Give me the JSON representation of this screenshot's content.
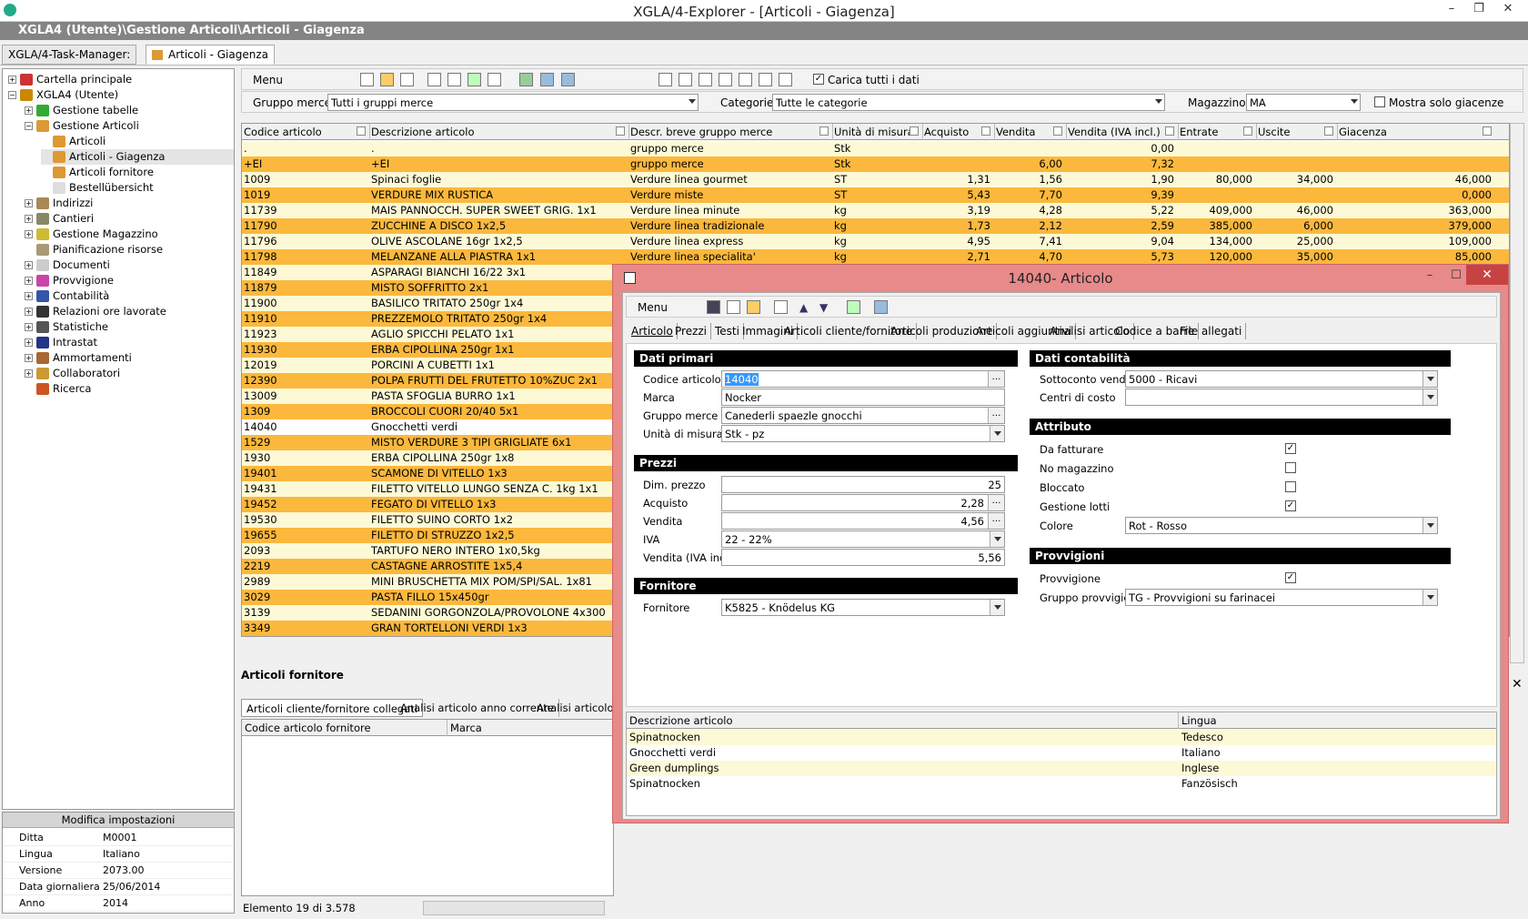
{
  "window": {
    "title": "XGLA/4-Explorer - [Articoli - Giagenza]",
    "path": "XGLA4 (Utente)\\Gestione Articoli\\Articoli - Giagenza"
  },
  "taskbar": {
    "tabs": [
      {
        "label": "XGLA/4-Task-Manager:"
      },
      {
        "label": "Articoli - Giagenza"
      }
    ]
  },
  "tree": {
    "items": [
      {
        "label": "Cartella principale",
        "level": 0,
        "exp": "+",
        "color": "#c33"
      },
      {
        "label": "XGLA4 (Utente)",
        "level": 0,
        "exp": "−",
        "color": "#c80"
      },
      {
        "label": "Gestione tabelle",
        "level": 1,
        "exp": "+",
        "color": "#3a3"
      },
      {
        "label": "Gestione Articoli",
        "level": 1,
        "exp": "−",
        "color": "#d93"
      },
      {
        "label": "Articoli",
        "level": 2,
        "exp": "",
        "color": "#d93"
      },
      {
        "label": "Articoli - Giagenza",
        "level": 2,
        "exp": "",
        "color": "#d93"
      },
      {
        "label": "Articoli fornitore",
        "level": 2,
        "exp": "",
        "color": "#d93"
      },
      {
        "label": "Bestellübersicht",
        "level": 2,
        "exp": "",
        "color": "#ddd"
      },
      {
        "label": "Indirizzi",
        "level": 1,
        "exp": "+",
        "color": "#a85"
      },
      {
        "label": "Cantieri",
        "level": 1,
        "exp": "+",
        "color": "#886"
      },
      {
        "label": "Gestione Magazzino",
        "level": 1,
        "exp": "+",
        "color": "#cb3"
      },
      {
        "label": "Pianificazione risorse",
        "level": 1,
        "exp": "",
        "color": "#a97"
      },
      {
        "label": "Documenti",
        "level": 1,
        "exp": "+",
        "color": "#ccc"
      },
      {
        "label": "Provvigione",
        "level": 1,
        "exp": "+",
        "color": "#c4a"
      },
      {
        "label": "Contabilità",
        "level": 1,
        "exp": "+",
        "color": "#35a"
      },
      {
        "label": "Relazioni ore lavorate",
        "level": 1,
        "exp": "+",
        "color": "#333"
      },
      {
        "label": "Statistiche",
        "level": 1,
        "exp": "+",
        "color": "#555"
      },
      {
        "label": "Intrastat",
        "level": 1,
        "exp": "+",
        "color": "#238"
      },
      {
        "label": "Ammortamenti",
        "level": 1,
        "exp": "+",
        "color": "#a63"
      },
      {
        "label": "Collaboratori",
        "level": 1,
        "exp": "+",
        "color": "#c93"
      },
      {
        "label": "Ricerca",
        "level": 1,
        "exp": "",
        "color": "#c52"
      }
    ]
  },
  "settings": {
    "title": "Modifica impostazioni",
    "rows": [
      {
        "k": "Ditta",
        "v": "M0001"
      },
      {
        "k": "Lingua",
        "v": "Italiano"
      },
      {
        "k": "Versione",
        "v": "2073.00"
      },
      {
        "k": "Data giornaliera",
        "v": "25/06/2014"
      },
      {
        "k": "Anno",
        "v": "2014"
      }
    ]
  },
  "toolbar": {
    "menu": "Menu",
    "load_all": "Carica tutti i dati",
    "load_all_checked": true
  },
  "filters": {
    "gruppo_label": "Gruppo merce:",
    "gruppo_value": "Tutti i gruppi merce",
    "categorie_label": "Categorie:",
    "categorie_value": "Tutte le categorie",
    "magazzino_label": "Magazzino:",
    "magazzino_value": "MA",
    "solo_giacenze": "Mostra solo giacenze"
  },
  "grid": {
    "columns": [
      "Codice articolo",
      "Descrizione articolo",
      "Descr. breve gruppo merce",
      "Unità di misura",
      "Acquisto",
      "Vendita",
      "Vendita (IVA incl.)",
      "Entrate",
      "Uscite",
      "Giacenza"
    ],
    "rows": [
      {
        "c": ".",
        "d": ".",
        "g": "gruppo merce",
        "u": "Stk",
        "a": "",
        "v": "",
        "vi": "0,00",
        "e": "",
        "us": "",
        "gi": "",
        "s": "y"
      },
      {
        "c": "+EI",
        "d": "+EI",
        "g": "gruppo merce",
        "u": "Stk",
        "a": "",
        "v": "6,00",
        "vi": "7,32",
        "e": "",
        "us": "",
        "gi": "",
        "s": "o"
      },
      {
        "c": "1009",
        "d": "Spinaci foglie",
        "g": "Verdure linea gourmet",
        "u": "ST",
        "a": "1,31",
        "v": "1,56",
        "vi": "1,90",
        "e": "80,000",
        "us": "34,000",
        "gi": "46,000",
        "s": "y"
      },
      {
        "c": "1019",
        "d": "VERDURE MIX RUSTICA",
        "g": "Verdure miste",
        "u": "ST",
        "a": "5,43",
        "v": "7,70",
        "vi": "9,39",
        "e": "",
        "us": "",
        "gi": "0,000",
        "s": "o"
      },
      {
        "c": "11739",
        "d": "MAIS PANNOCCH. SUPER SWEET GRIG.   1x1",
        "g": "Verdure linea minute",
        "u": "kg",
        "a": "3,19",
        "v": "4,28",
        "vi": "5,22",
        "e": "409,000",
        "us": "46,000",
        "gi": "363,000",
        "s": "y"
      },
      {
        "c": "11790",
        "d": "ZUCCHINE A DISCO                  1x2,5",
        "g": "Verdure linea tradizionale",
        "u": "kg",
        "a": "1,73",
        "v": "2,12",
        "vi": "2,59",
        "e": "385,000",
        "us": "6,000",
        "gi": "379,000",
        "s": "o"
      },
      {
        "c": "11796",
        "d": "OLIVE ASCOLANE 16gr               1x2,5",
        "g": "Verdure linea express",
        "u": "kg",
        "a": "4,95",
        "v": "7,41",
        "vi": "9,04",
        "e": "134,000",
        "us": "25,000",
        "gi": "109,000",
        "s": "y"
      },
      {
        "c": "11798",
        "d": "MELANZANE ALLA PIASTRA                1x1",
        "g": "Verdure linea specialita'",
        "u": "kg",
        "a": "2,71",
        "v": "4,70",
        "vi": "5,73",
        "e": "120,000",
        "us": "35,000",
        "gi": "85,000",
        "s": "o"
      },
      {
        "c": "11849",
        "d": "ASPARAGI BIANCHI 16/22            3x1",
        "s": "y"
      },
      {
        "c": "11879",
        "d": "MISTO SOFFRITTO                   2x1",
        "s": "o"
      },
      {
        "c": "11900",
        "d": "BASILICO TRITATO 250gr            1x4",
        "s": "y"
      },
      {
        "c": "11910",
        "d": "PREZZEMOLO TRITATO 250gr          1x4",
        "s": "o"
      },
      {
        "c": "11923",
        "d": "AGLIO SPICCHI PELATO              1x1",
        "s": "y"
      },
      {
        "c": "11930",
        "d": "ERBA CIPOLLINA 250gr              1x1",
        "s": "o"
      },
      {
        "c": "12019",
        "d": "PORCINI A CUBETTI                 1x1",
        "s": "y"
      },
      {
        "c": "12390",
        "d": "POLPA FRUTTI DEL FRUTETTO 10%ZUC  2x1",
        "s": "o"
      },
      {
        "c": "13009",
        "d": "PASTA SFOGLIA BURRO               1x1",
        "s": "y"
      },
      {
        "c": "1309",
        "d": "BROCCOLI CUORI 20/40              5x1",
        "s": "o"
      },
      {
        "c": "14040",
        "d": "Gnocchetti verdi",
        "s": "w"
      },
      {
        "c": "1529",
        "d": "MISTO VERDURE 3 TIPI GRIGLIATE    6x1",
        "s": "o"
      },
      {
        "c": "1930",
        "d": "ERBA CIPOLLINA 250gr              1x8",
        "s": "y"
      },
      {
        "c": "19401",
        "d": "SCAMONE DI VITELLO                1x3",
        "s": "o"
      },
      {
        "c": "19431",
        "d": "FILETTO VITELLO LUNGO SENZA C. 1kg 1x1",
        "s": "y"
      },
      {
        "c": "19452",
        "d": "FEGATO DI VITELLO                 1x3",
        "s": "o"
      },
      {
        "c": "19530",
        "d": "FILETTO SUINO CORTO               1x2",
        "s": "y"
      },
      {
        "c": "19655",
        "d": "FILETTO DI STRUZZO                1x2,5",
        "s": "o"
      },
      {
        "c": "2093",
        "d": "TARTUFO NERO INTERO               1x0,5kg",
        "s": "y"
      },
      {
        "c": "2219",
        "d": "CASTAGNE ARROSTITE                1x5,4",
        "s": "o"
      },
      {
        "c": "2989",
        "d": "MINI BRUSCHETTA MIX POM/SPI/SAL.  1x81",
        "s": "y"
      },
      {
        "c": "3029",
        "d": "PASTA FILLO              15x450gr",
        "s": "o"
      },
      {
        "c": "3139",
        "d": "SEDANINI GORGONZOLA/PROVOLONE    4x300",
        "s": "y"
      },
      {
        "c": "3349",
        "d": "GRAN TORTELLONI VERDI             1x3",
        "s": "o"
      }
    ]
  },
  "lower": {
    "title": "Articoli fornitore",
    "tabs": [
      "Articoli cliente/fornitore collegati",
      "Analisi articolo anno corrente",
      "Analisi articolo di t"
    ],
    "columns": [
      "Codice articolo fornitore",
      "Marca"
    ]
  },
  "status": {
    "text": "Elemento 19 di 3.578"
  },
  "dialog": {
    "title": "14040- Articolo",
    "menu": "Menu",
    "tabs": [
      "Articolo",
      "Prezzi",
      "Testi",
      "Immagini",
      "Articoli cliente/fornitore",
      "Articoli produzione",
      "Articoli aggiuntivi",
      "Analisi articolo",
      "Codice a barre",
      "File allegati"
    ],
    "primari": {
      "title": "Dati primari",
      "codice_label": "Codice articolo",
      "codice": "14040",
      "marca_label": "Marca",
      "marca": "Nocker",
      "gruppo_label": "Gruppo merce",
      "gruppo": "Canederli spaezle gnocchi",
      "unita_label": "Unità di misura",
      "unita": "Stk - pz"
    },
    "prezzi": {
      "title": "Prezzi",
      "dim_label": "Dim. prezzo",
      "dim": "25",
      "acquisto_label": "Acquisto",
      "acquisto": "2,28",
      "vendita_label": "Vendita",
      "vendita": "4,56",
      "iva_label": "IVA",
      "iva": "22 - 22%",
      "vendita_iva_label": "Vendita (IVA incl.)",
      "vendita_iva": "5,56"
    },
    "fornitore": {
      "title": "Fornitore",
      "label": "Fornitore",
      "value": "K5825 - Knödelus KG"
    },
    "contab": {
      "title": "Dati contabilità",
      "sottoconto_label": "Sottoconto vendite",
      "sottoconto": "5000  - Ricavi",
      "centri_label": "Centri di costo",
      "centri": ""
    },
    "attributo": {
      "title": "Attributo",
      "da_fatturare": "Da fatturare",
      "da_fatturare_checked": true,
      "no_magazzino": "No magazzino",
      "no_magazzino_checked": false,
      "bloccato": "Bloccato",
      "bloccato_checked": false,
      "lotti": "Gestione lotti",
      "lotti_checked": true,
      "colore_label": "Colore",
      "colore": "Rot - Rosso"
    },
    "provvigioni": {
      "title": "Provvigioni",
      "provvigione": "Provvigione",
      "provvigione_checked": true,
      "gruppo_label": "Gruppo provvigioni",
      "gruppo": "TG - Provvigioni su farinacei"
    },
    "desc": {
      "columns": [
        "Descrizione articolo",
        "Lingua"
      ],
      "rows": [
        {
          "d": "Spinatnocken",
          "l": "Tedesco"
        },
        {
          "d": "Gnocchetti verdi",
          "l": "Italiano"
        },
        {
          "d": "Green dumplings",
          "l": "Inglese"
        },
        {
          "d": "Spinatnocken",
          "l": "Fanzösisch"
        }
      ]
    }
  }
}
